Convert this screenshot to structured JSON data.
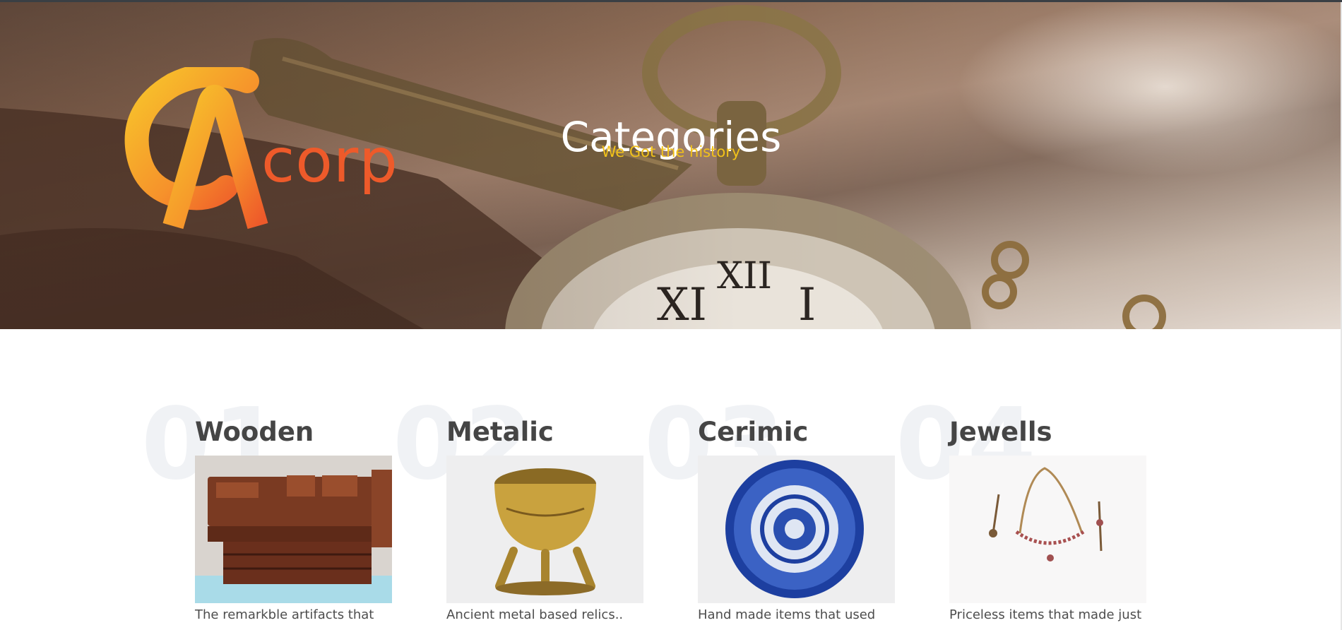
{
  "hero": {
    "title": "Categories",
    "subtitle": "We Got the history",
    "logo_text": "corp",
    "logo_letter": "A"
  },
  "categories": [
    {
      "number": "01",
      "title": "Wooden",
      "description": "The remarkble artifacts that",
      "image": "wooden-box-image"
    },
    {
      "number": "02",
      "title": "Metalic",
      "description": "Ancient metal based relics..",
      "image": "brass-bowl-image"
    },
    {
      "number": "03",
      "title": "Cerimic",
      "description": "Hand made items that used",
      "image": "blue-plate-image"
    },
    {
      "number": "04",
      "title": "Jewells",
      "description": "Priceless items that made just",
      "image": "necklace-image"
    }
  ],
  "colors": {
    "accent_subtitle": "#f2c21a",
    "logo_orange": "#ee5a2a",
    "logo_yellow": "#f7c52b",
    "number_watermark": "#f0f2f5",
    "heading": "#454545"
  }
}
